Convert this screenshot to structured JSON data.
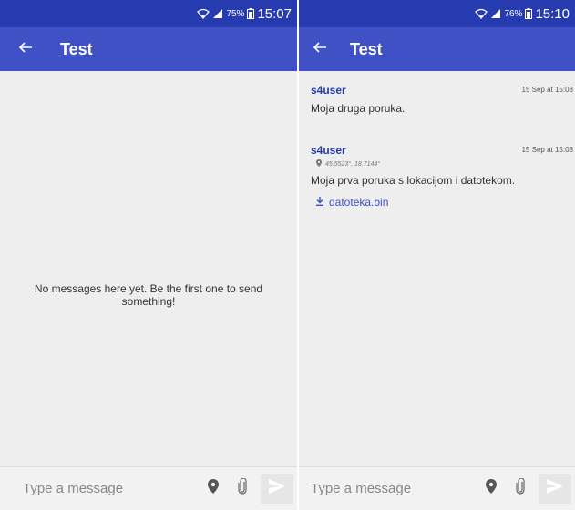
{
  "left_screen": {
    "status": {
      "battery_percent": "75%",
      "time": "15:07"
    },
    "appbar": {
      "title": "Test",
      "back_icon": "arrow-left-icon"
    },
    "empty_text": "No messages here yet. Be the first one to send something!",
    "composer": {
      "placeholder": "Type a message",
      "location_icon": "map-pin-icon",
      "attach_icon": "paperclip-icon",
      "send_icon": "send-icon"
    }
  },
  "right_screen": {
    "status": {
      "battery_percent": "76%",
      "time": "15:10"
    },
    "appbar": {
      "title": "Test",
      "back_icon": "arrow-left-icon"
    },
    "messages": [
      {
        "author": "s4user",
        "time": "15 Sep at 15:08",
        "text": "Moja druga poruka."
      },
      {
        "author": "s4user",
        "time": "15 Sep at 15:08",
        "location": "45.5523°, 18.7144°",
        "text": "Moja prva poruka s lokacijom i datotekom.",
        "attachment": "datoteka.bin"
      }
    ],
    "composer": {
      "placeholder": "Type a message",
      "location_icon": "map-pin-icon",
      "attach_icon": "paperclip-icon",
      "send_icon": "send-icon"
    }
  },
  "colors": {
    "status_bar": "#273bb0",
    "app_bar": "#3f51c5",
    "background": "#eeeeee",
    "author": "#273bb0",
    "link": "#3f51c5"
  }
}
